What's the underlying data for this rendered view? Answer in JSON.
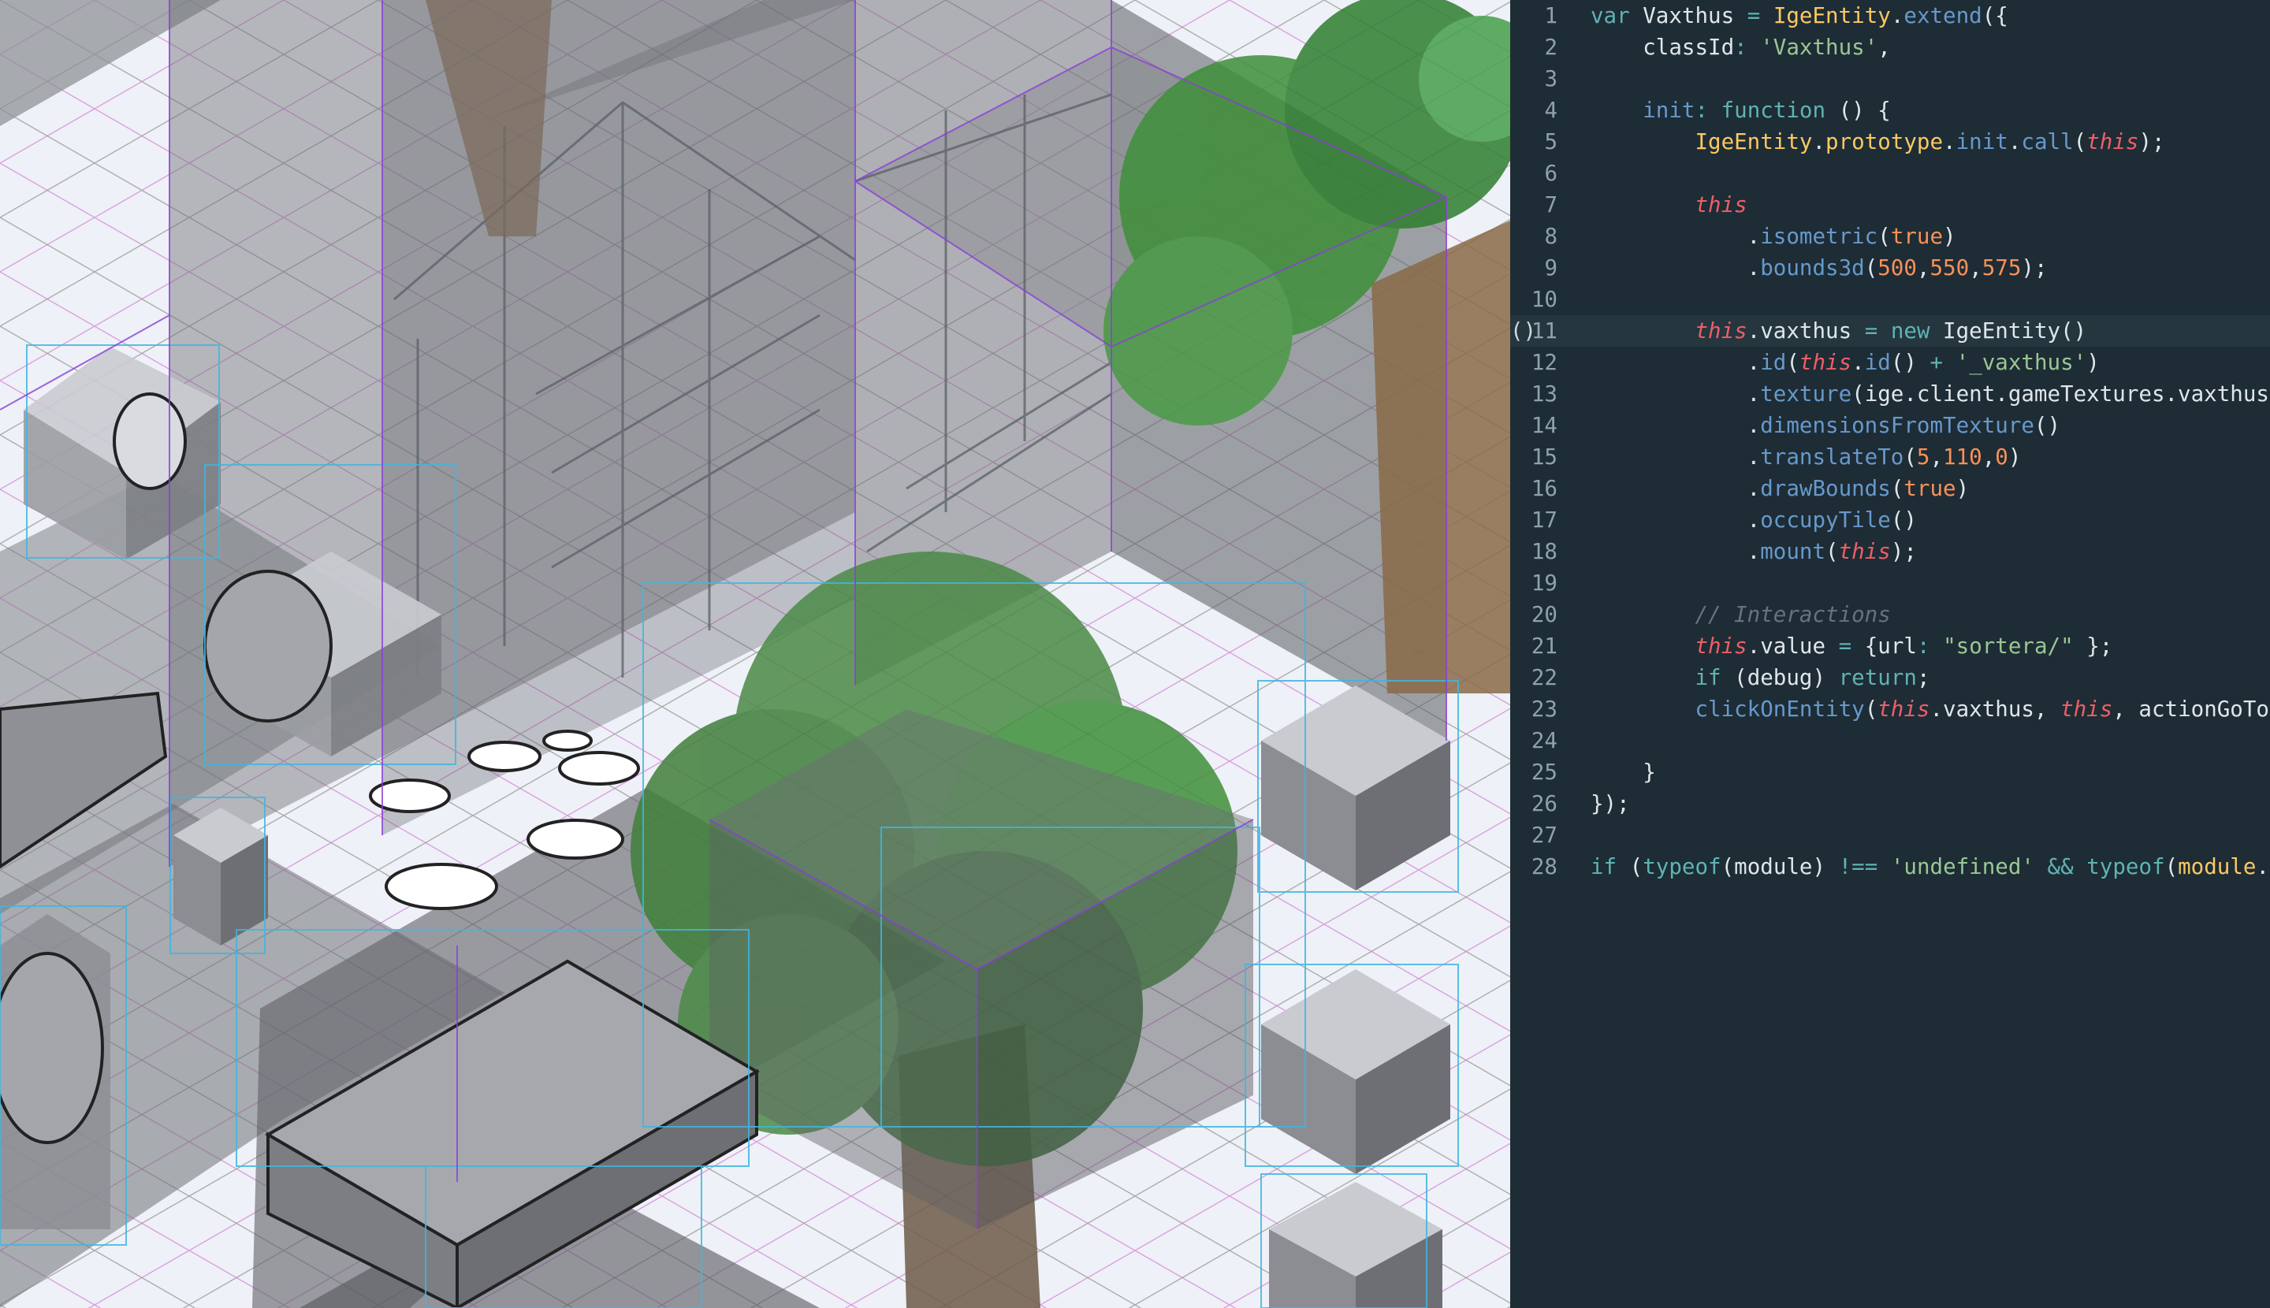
{
  "colors": {
    "editor_bg": "#1e2c35",
    "active_line_bg": "#25363f",
    "line_number": "#8fa1ab",
    "plain": "#dfe6ea",
    "keyword": "#5fb3b3",
    "string": "#99c794",
    "number": "#f99157",
    "this_keyword": "#ec5f67",
    "function_name": "#6699cc",
    "class_name": "#fac863",
    "comment": "#65737e",
    "scene_bg": "#eef1f7",
    "grid_magenta": "#d36fd3",
    "grid_green": "#7fbf7f",
    "bounds_blue": "#3fb6e0",
    "bounds_purple": "#8a3fd6",
    "tree_green": "#3f8f3a",
    "overlay_gray": "#6d6f74"
  },
  "scene": {
    "description_label": "Isometric game scene with debug bounding boxes"
  },
  "editor": {
    "gutter_marker": "()",
    "active_line": 11,
    "lines": [
      {
        "n": "1",
        "tokens": [
          [
            "kw",
            "var"
          ],
          [
            "p",
            " Vaxthus "
          ],
          [
            "kw",
            "="
          ],
          [
            "p",
            " "
          ],
          [
            "cls",
            "IgeEntity"
          ],
          [
            "p",
            "."
          ],
          [
            "fn",
            "extend"
          ],
          [
            "p",
            "({"
          ]
        ]
      },
      {
        "n": "2",
        "tokens": [
          [
            "p",
            "    classId"
          ],
          [
            "kw",
            ":"
          ],
          [
            "p",
            " "
          ],
          [
            "str",
            "'Vaxthus'"
          ],
          [
            "p",
            ","
          ]
        ]
      },
      {
        "n": "3",
        "tokens": []
      },
      {
        "n": "4",
        "tokens": [
          [
            "p",
            "    "
          ],
          [
            "fn",
            "init"
          ],
          [
            "kw",
            ":"
          ],
          [
            "p",
            " "
          ],
          [
            "kw",
            "function"
          ],
          [
            "p",
            " () {"
          ]
        ]
      },
      {
        "n": "5",
        "tokens": [
          [
            "p",
            "        "
          ],
          [
            "cls",
            "IgeEntity"
          ],
          [
            "p",
            "."
          ],
          [
            "cls",
            "prototype"
          ],
          [
            "p",
            "."
          ],
          [
            "fn",
            "init"
          ],
          [
            "p",
            "."
          ],
          [
            "fn",
            "call"
          ],
          [
            "p",
            "("
          ],
          [
            "this",
            "this"
          ],
          [
            "p",
            ");"
          ]
        ]
      },
      {
        "n": "6",
        "tokens": []
      },
      {
        "n": "7",
        "tokens": [
          [
            "p",
            "        "
          ],
          [
            "this",
            "this"
          ]
        ]
      },
      {
        "n": "8",
        "tokens": [
          [
            "p",
            "            ."
          ],
          [
            "fn",
            "isometric"
          ],
          [
            "p",
            "("
          ],
          [
            "num",
            "true"
          ],
          [
            "p",
            ")"
          ]
        ]
      },
      {
        "n": "9",
        "tokens": [
          [
            "p",
            "            ."
          ],
          [
            "fn",
            "bounds3d"
          ],
          [
            "p",
            "("
          ],
          [
            "num",
            "500"
          ],
          [
            "p",
            ","
          ],
          [
            "num",
            "550"
          ],
          [
            "p",
            ","
          ],
          [
            "num",
            "575"
          ],
          [
            "p",
            ");"
          ]
        ]
      },
      {
        "n": "10",
        "tokens": []
      },
      {
        "n": "11",
        "tokens": [
          [
            "p",
            "        "
          ],
          [
            "this",
            "this"
          ],
          [
            "p",
            ".vaxthus "
          ],
          [
            "kw",
            "="
          ],
          [
            "p",
            " "
          ],
          [
            "kw",
            "new"
          ],
          [
            "p",
            " IgeEntity()"
          ]
        ]
      },
      {
        "n": "12",
        "tokens": [
          [
            "p",
            "            ."
          ],
          [
            "fn",
            "id"
          ],
          [
            "p",
            "("
          ],
          [
            "this",
            "this"
          ],
          [
            "p",
            "."
          ],
          [
            "fn",
            "id"
          ],
          [
            "p",
            "() "
          ],
          [
            "kw",
            "+"
          ],
          [
            "p",
            " "
          ],
          [
            "str",
            "'_vaxthus'"
          ],
          [
            "p",
            ")"
          ]
        ]
      },
      {
        "n": "13",
        "tokens": [
          [
            "p",
            "            ."
          ],
          [
            "fn",
            "texture"
          ],
          [
            "p",
            "(ige.client.gameTextures.vaxthus)"
          ]
        ]
      },
      {
        "n": "14",
        "tokens": [
          [
            "p",
            "            ."
          ],
          [
            "fn",
            "dimensionsFromTexture"
          ],
          [
            "p",
            "()"
          ]
        ]
      },
      {
        "n": "15",
        "tokens": [
          [
            "p",
            "            ."
          ],
          [
            "fn",
            "translateTo"
          ],
          [
            "p",
            "("
          ],
          [
            "num",
            "5"
          ],
          [
            "p",
            ","
          ],
          [
            "num",
            "110"
          ],
          [
            "p",
            ","
          ],
          [
            "num",
            "0"
          ],
          [
            "p",
            ")"
          ]
        ]
      },
      {
        "n": "16",
        "tokens": [
          [
            "p",
            "            ."
          ],
          [
            "fn",
            "drawBounds"
          ],
          [
            "p",
            "("
          ],
          [
            "num",
            "true"
          ],
          [
            "p",
            ")"
          ]
        ]
      },
      {
        "n": "17",
        "tokens": [
          [
            "p",
            "            ."
          ],
          [
            "fn",
            "occupyTile"
          ],
          [
            "p",
            "()"
          ]
        ]
      },
      {
        "n": "18",
        "tokens": [
          [
            "p",
            "            ."
          ],
          [
            "fn",
            "mount"
          ],
          [
            "p",
            "("
          ],
          [
            "this",
            "this"
          ],
          [
            "p",
            ");"
          ]
        ]
      },
      {
        "n": "19",
        "tokens": []
      },
      {
        "n": "20",
        "tokens": [
          [
            "p",
            "        "
          ],
          [
            "cmt",
            "// Interactions"
          ]
        ]
      },
      {
        "n": "21",
        "tokens": [
          [
            "p",
            "        "
          ],
          [
            "this",
            "this"
          ],
          [
            "p",
            ".value "
          ],
          [
            "kw",
            "="
          ],
          [
            "p",
            " {url"
          ],
          [
            "kw",
            ":"
          ],
          [
            "p",
            " "
          ],
          [
            "str",
            "\"sortera/\""
          ],
          [
            "p",
            " };"
          ]
        ]
      },
      {
        "n": "22",
        "tokens": [
          [
            "p",
            "        "
          ],
          [
            "kw",
            "if"
          ],
          [
            "p",
            " (debug) "
          ],
          [
            "kw",
            "return"
          ],
          [
            "p",
            ";"
          ]
        ]
      },
      {
        "n": "23",
        "tokens": [
          [
            "p",
            "        "
          ],
          [
            "fn",
            "clickOnEntity"
          ],
          [
            "p",
            "("
          ],
          [
            "this",
            "this"
          ],
          [
            "p",
            ".vaxthus, "
          ],
          [
            "this",
            "this"
          ],
          [
            "p",
            ", actionGoToPa"
          ]
        ]
      },
      {
        "n": "24",
        "tokens": []
      },
      {
        "n": "25",
        "tokens": [
          [
            "p",
            "    }"
          ]
        ]
      },
      {
        "n": "26",
        "tokens": [
          [
            "p",
            "});"
          ]
        ]
      },
      {
        "n": "27",
        "tokens": []
      },
      {
        "n": "28",
        "tokens": [
          [
            "kw",
            "if"
          ],
          [
            "p",
            " ("
          ],
          [
            "kw",
            "typeof"
          ],
          [
            "p",
            "(module) "
          ],
          [
            "kw",
            "!=="
          ],
          [
            "p",
            " "
          ],
          [
            "str",
            "'undefined'"
          ],
          [
            "p",
            " "
          ],
          [
            "kw",
            "&&"
          ],
          [
            "p",
            " "
          ],
          [
            "kw",
            "typeof"
          ],
          [
            "p",
            "("
          ],
          [
            "cls",
            "module"
          ],
          [
            "p",
            ".ex"
          ]
        ]
      }
    ]
  }
}
